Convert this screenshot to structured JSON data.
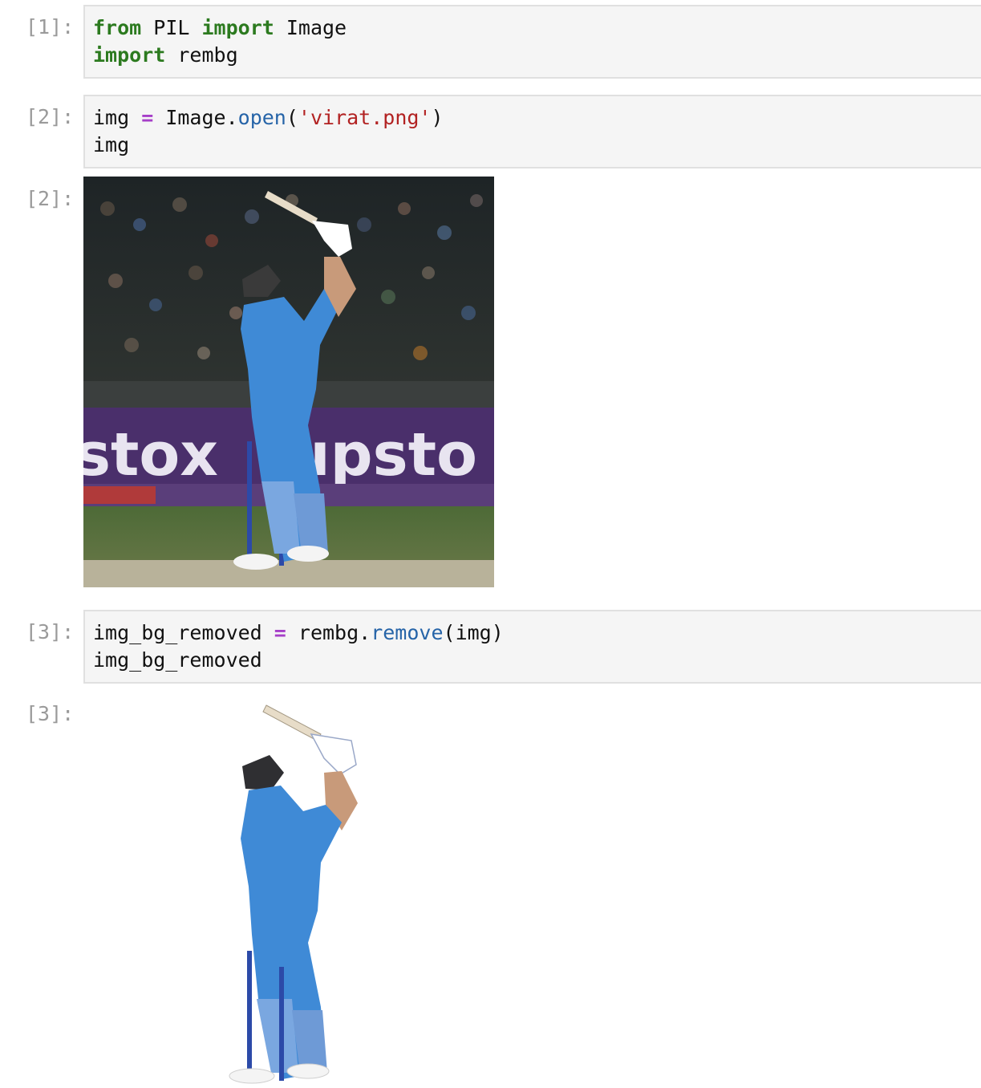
{
  "cells": [
    {
      "prompt": "[1]:",
      "lines": [
        [
          {
            "t": "from",
            "c": "kw"
          },
          {
            "t": " PIL ",
            "c": ""
          },
          {
            "t": "import",
            "c": "kw"
          },
          {
            "t": " Image",
            "c": ""
          }
        ],
        [
          {
            "t": "import",
            "c": "kw"
          },
          {
            "t": " rembg",
            "c": ""
          }
        ]
      ]
    },
    {
      "prompt": "[2]:",
      "lines": [
        [
          {
            "t": "img ",
            "c": ""
          },
          {
            "t": "=",
            "c": "op"
          },
          {
            "t": " Image.",
            "c": ""
          },
          {
            "t": "open",
            "c": "fn"
          },
          {
            "t": "(",
            "c": ""
          },
          {
            "t": "'virat.png'",
            "c": "str"
          },
          {
            "t": ")",
            "c": ""
          }
        ],
        [
          {
            "t": "img",
            "c": ""
          }
        ]
      ]
    },
    {
      "prompt": "[3]:",
      "lines": [
        [
          {
            "t": "img_bg_removed ",
            "c": ""
          },
          {
            "t": "=",
            "c": "op"
          },
          {
            "t": " rembg.",
            "c": ""
          },
          {
            "t": "remove",
            "c": "fn"
          },
          {
            "t": "(img)",
            "c": ""
          }
        ],
        [
          {
            "t": "img_bg_removed",
            "c": ""
          }
        ]
      ]
    }
  ],
  "outputs": [
    {
      "prompt": "[2]:",
      "image_icon": "cricket-batsman-photo"
    },
    {
      "prompt": "[3]:",
      "image_icon": "cricket-batsman-cutout"
    }
  ],
  "photo_banner": {
    "left_text": "stox",
    "right_text": "upsto"
  },
  "colors": {
    "keyword": "#2c7a1f",
    "operator": "#a63fc8",
    "function": "#2664a8",
    "string": "#b22222",
    "prompt": "#9a9a9a"
  }
}
